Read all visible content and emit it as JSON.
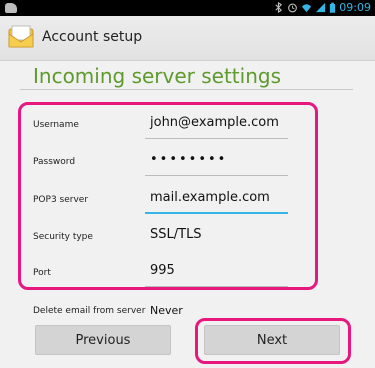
{
  "status_bar": {
    "time": "09:09",
    "icons": [
      "notification-icon",
      "bluetooth-icon",
      "alarm-icon",
      "wifi-icon",
      "signal-icon",
      "battery-icon"
    ]
  },
  "action_bar": {
    "title": "Account setup",
    "icon": "email-envelope-icon"
  },
  "page": {
    "heading": "Incoming server settings"
  },
  "form": {
    "username": {
      "label": "Username",
      "value": "john@example.com"
    },
    "password": {
      "label": "Password",
      "value": "••••••••"
    },
    "server": {
      "label": "POP3 server",
      "value": "mail.example.com"
    },
    "security": {
      "label": "Security type",
      "value": "SSL/TLS"
    },
    "port": {
      "label": "Port",
      "value": "995"
    },
    "delete": {
      "label": "Delete email from server",
      "value": "Never"
    }
  },
  "buttons": {
    "previous": "Previous",
    "next": "Next"
  },
  "colors": {
    "accent": "#33b5e5",
    "heading": "#5e9a2c",
    "highlight": "#e6177f"
  }
}
